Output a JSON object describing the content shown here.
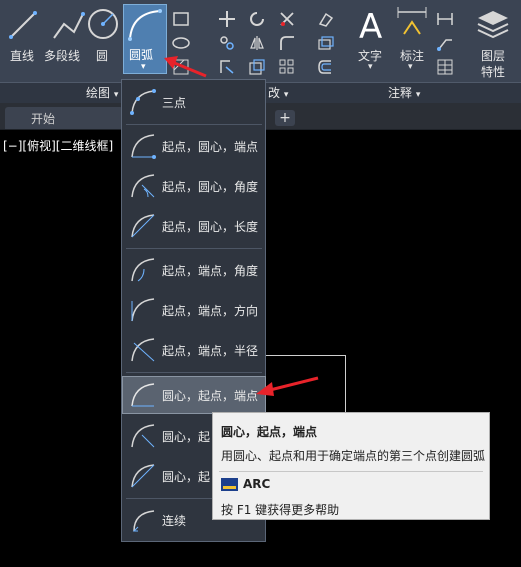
{
  "ribbon": {
    "tools": {
      "line": "直线",
      "polyline": "多段线",
      "circle": "圆",
      "arc": "圆弧",
      "text": "文字",
      "dimension": "标注",
      "layer_props_line1": "图层",
      "layer_props_line2": "特性"
    },
    "panels": {
      "draw": "绘图",
      "modify_partial": "改",
      "annotation": "注释"
    }
  },
  "tabs": {
    "start": "开始",
    "add": "+"
  },
  "viewport": {
    "label": "[−][俯视][二维线框]"
  },
  "arc_menu": {
    "items": [
      {
        "label": "三点"
      },
      {
        "label": "起点，圆心，端点"
      },
      {
        "label": "起点，圆心，角度"
      },
      {
        "label": "起点，圆心，长度"
      },
      {
        "label": "起点，端点，角度"
      },
      {
        "label": "起点，端点，方向"
      },
      {
        "label": "起点，端点，半径"
      },
      {
        "label": "圆心，起点，端点"
      },
      {
        "label": "圆心，起"
      },
      {
        "label": "圆心，起"
      },
      {
        "label": "连续"
      }
    ]
  },
  "tooltip": {
    "title": "圆心，起点，端点",
    "description": "用圆心、起点和用于确定端点的第三个点创建圆弧",
    "command": "ARC",
    "help": "按 F1 键获得更多帮助"
  },
  "colors": {
    "ribbon_bg": "#3b4453",
    "active_blue": "#4f7fb0",
    "annotation_red": "#e8232a",
    "menu_bg": "#2f353f",
    "tooltip_bg": "#f0f0f0"
  }
}
